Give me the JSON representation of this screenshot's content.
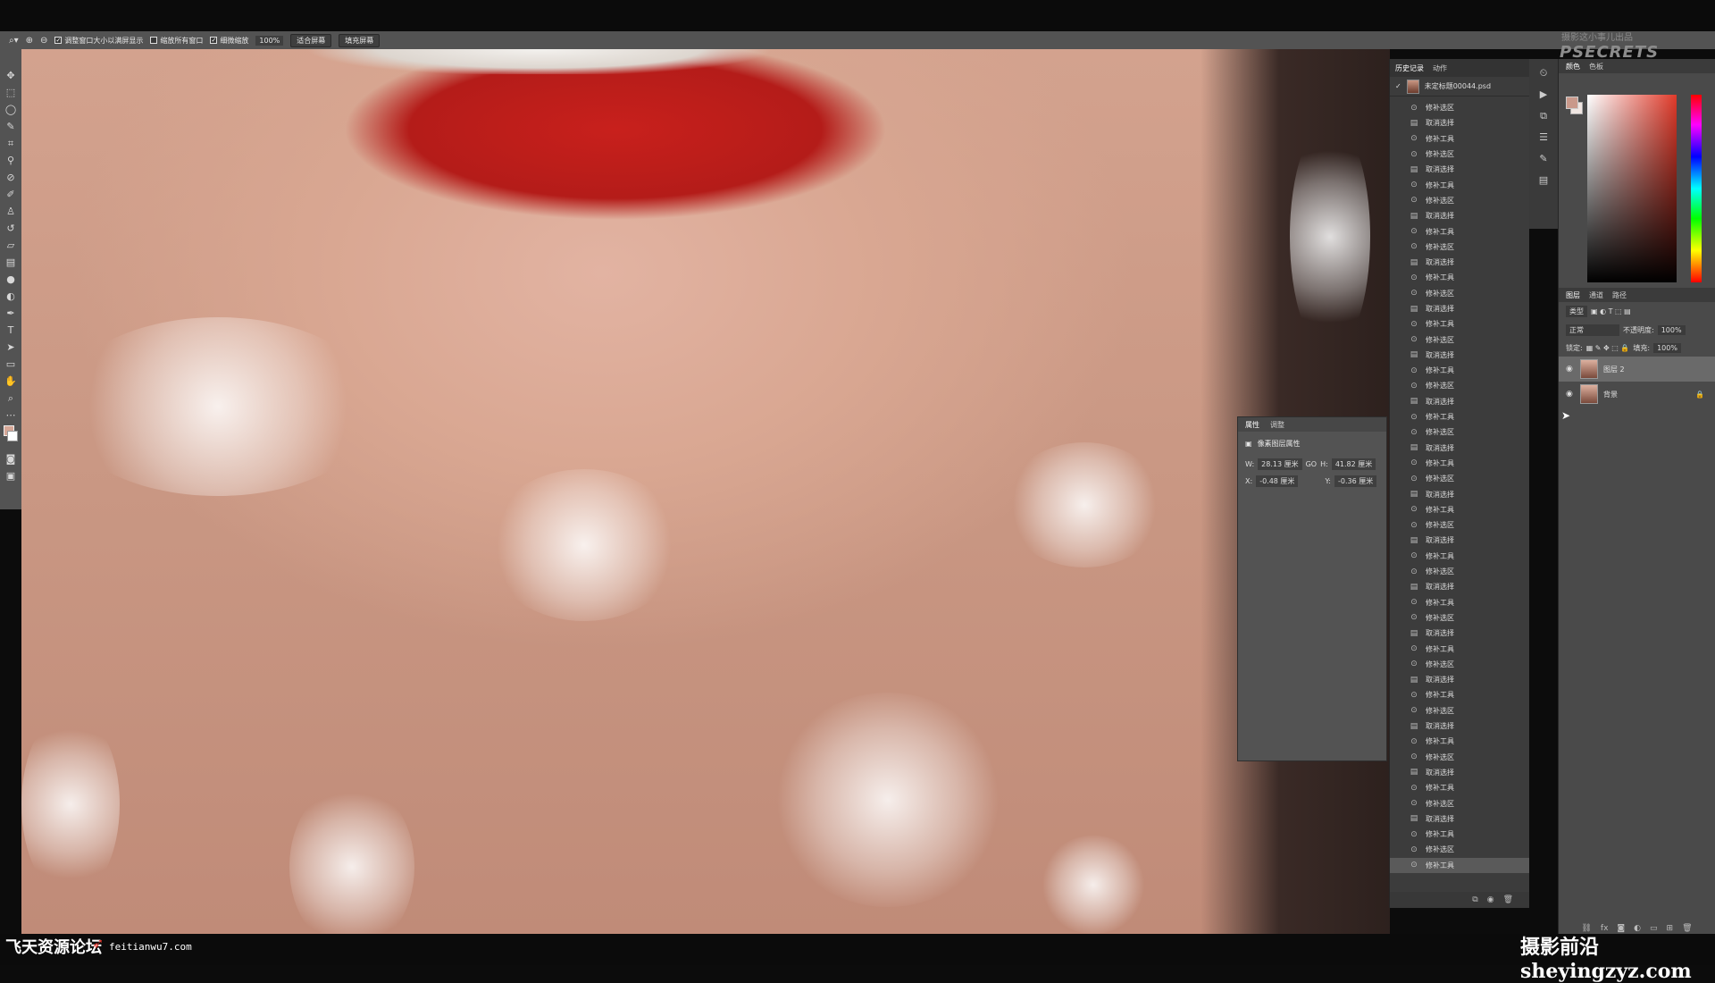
{
  "options_bar": {
    "resize_window_label": "调整窗口大小以满屏显示",
    "zoom_all_label": "缩放所有窗口",
    "scrubby_zoom_label": "细微缩放",
    "zoom_value": "100%",
    "fit_screen_label": "适合屏幕",
    "fill_screen_label": "填充屏幕"
  },
  "history_panel": {
    "tabs": [
      "历史记录",
      "动作"
    ],
    "snapshot_name": "未定标题00044.psd",
    "items": [
      "修补选区",
      "取消选择",
      "修补工具",
      "修补选区",
      "取消选择",
      "修补工具",
      "修补选区",
      "取消选择",
      "修补工具",
      "修补选区",
      "取消选择",
      "修补工具",
      "修补选区",
      "取消选择",
      "修补工具",
      "修补选区",
      "取消选择",
      "修补工具",
      "修补选区",
      "取消选择",
      "修补工具",
      "修补选区",
      "取消选择",
      "修补工具",
      "修补选区",
      "取消选择",
      "修补工具",
      "修补选区",
      "取消选择",
      "修补工具",
      "修补选区",
      "取消选择",
      "修补工具",
      "修补选区",
      "取消选择",
      "修补工具",
      "修补选区",
      "取消选择",
      "修补工具",
      "修补选区",
      "取消选择",
      "修补工具",
      "修补选区",
      "取消选择",
      "修补工具",
      "修补选区",
      "取消选择",
      "修补工具",
      "修补选区",
      "修补工具"
    ]
  },
  "properties_panel": {
    "tabs": [
      "属性",
      "调整"
    ],
    "title": "像素图层属性",
    "w_label": "W:",
    "w_value": "28.13 厘米",
    "link_icon": "GO",
    "h_label": "H:",
    "h_value": "41.82 厘米",
    "x_label": "X:",
    "x_value": "-0.48 厘米",
    "y_label": "Y:",
    "y_value": "-0.36 厘米"
  },
  "brand": {
    "sub": "摄影这小事儿出品",
    "main": "PSECRETS"
  },
  "color_panel": {
    "tabs": [
      "颜色",
      "色板"
    ]
  },
  "layers_panel": {
    "tabs": [
      "图层",
      "通道",
      "路径"
    ],
    "kind_label": "类型",
    "blend_mode": "正常",
    "opacity_label": "不透明度:",
    "opacity_value": "100%",
    "lock_label": "锁定:",
    "fill_label": "填充:",
    "fill_value": "100%",
    "layers": [
      {
        "name": "图层 2"
      },
      {
        "name": "背景"
      }
    ]
  },
  "watermark": {
    "left_main": "飞天资源论坛",
    "left_sub": "feitianwu7.com",
    "right": "摄影前沿 sheyingzyz.com"
  }
}
